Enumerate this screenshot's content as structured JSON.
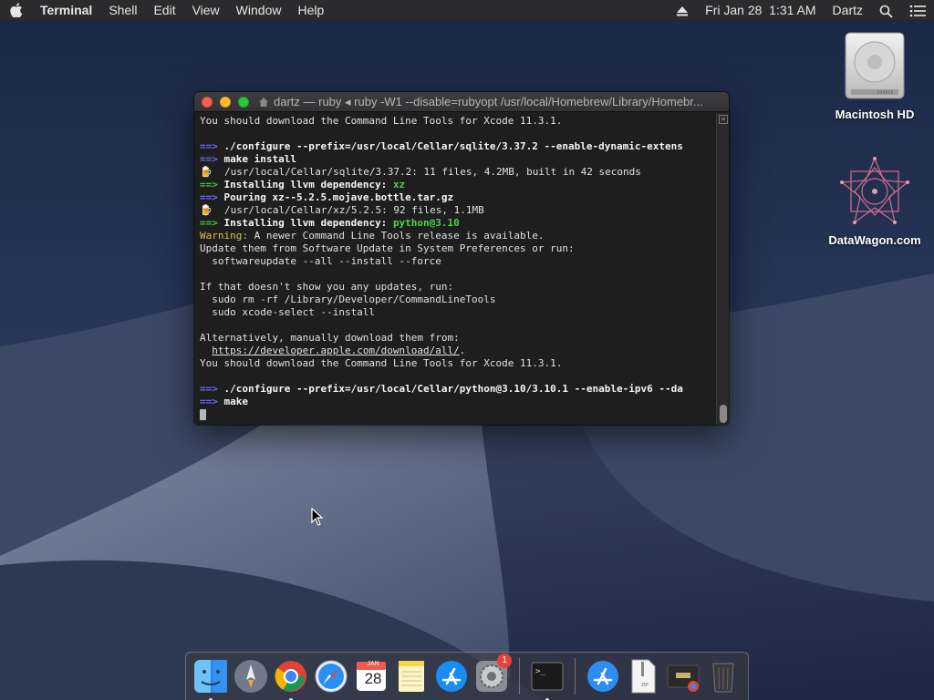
{
  "menubar": {
    "apple": "",
    "app_name": "Terminal",
    "items": [
      "Shell",
      "Edit",
      "View",
      "Window",
      "Help"
    ],
    "clock": "Fri Jan 28  1:31 AM",
    "user": "Dartz"
  },
  "desktop": {
    "icons": [
      {
        "label": "Macintosh HD",
        "icon": "hard-drive-icon"
      },
      {
        "label": "DataWagon.com",
        "icon": "geometric-star-icon"
      }
    ]
  },
  "terminal": {
    "title": "dartz — ruby ◂ ruby -W1 --disable=rubyopt /usr/local/Homebrew/Library/Homebr...",
    "lines": [
      [
        {
          "t": "You should download the Command Line Tools for Xcode 11.3.1.",
          "c": ""
        }
      ],
      [
        {
          "t": "",
          "c": ""
        }
      ],
      [
        {
          "t": "==> ",
          "c": "arrow-blue"
        },
        {
          "t": "./configure --prefix=/usr/local/Cellar/sqlite/3.37.2 --enable-dynamic-extens",
          "c": "bold"
        }
      ],
      [
        {
          "t": "==> ",
          "c": "arrow-blue"
        },
        {
          "t": "make install",
          "c": "bold"
        }
      ],
      [
        {
          "t": "🍺  ",
          "c": "beer"
        },
        {
          "t": "/usr/local/Cellar/sqlite/3.37.2: 11 files, 4.2MB, built in 42 seconds",
          "c": ""
        }
      ],
      [
        {
          "t": "==> ",
          "c": "arrow-green"
        },
        {
          "t": "Installing llvm dependency: ",
          "c": "bold"
        },
        {
          "t": "xz",
          "c": "green"
        }
      ],
      [
        {
          "t": "==> ",
          "c": "arrow-blue"
        },
        {
          "t": "Pouring xz--5.2.5.mojave.bottle.tar.gz",
          "c": "bold"
        }
      ],
      [
        {
          "t": "🍺  ",
          "c": "beer"
        },
        {
          "t": "/usr/local/Cellar/xz/5.2.5: 92 files, 1.1MB",
          "c": ""
        }
      ],
      [
        {
          "t": "==> ",
          "c": "arrow-green"
        },
        {
          "t": "Installing llvm dependency: ",
          "c": "bold"
        },
        {
          "t": "python@3.10",
          "c": "green"
        }
      ],
      [
        {
          "t": "Warning:",
          "c": "yellow"
        },
        {
          "t": " A newer Command Line Tools release is available.",
          "c": ""
        }
      ],
      [
        {
          "t": "Update them from Software Update in System Preferences or run:",
          "c": ""
        }
      ],
      [
        {
          "t": "  softwareupdate --all --install --force",
          "c": ""
        }
      ],
      [
        {
          "t": "",
          "c": ""
        }
      ],
      [
        {
          "t": "If that doesn't show you any updates, run:",
          "c": ""
        }
      ],
      [
        {
          "t": "  sudo rm -rf /Library/Developer/CommandLineTools",
          "c": ""
        }
      ],
      [
        {
          "t": "  sudo xcode-select --install",
          "c": ""
        }
      ],
      [
        {
          "t": "",
          "c": ""
        }
      ],
      [
        {
          "t": "Alternatively, manually download them from:",
          "c": ""
        }
      ],
      [
        {
          "t": "  ",
          "c": ""
        },
        {
          "t": "https://developer.apple.com/download/all/",
          "c": "underline"
        },
        {
          "t": ".",
          "c": ""
        }
      ],
      [
        {
          "t": "You should download the Command Line Tools for Xcode 11.3.1.",
          "c": ""
        }
      ],
      [
        {
          "t": "",
          "c": ""
        }
      ],
      [
        {
          "t": "==> ",
          "c": "arrow-blue"
        },
        {
          "t": "./configure --prefix=/usr/local/Cellar/python@3.10/3.10.1 --enable-ipv6 --da",
          "c": "bold"
        }
      ],
      [
        {
          "t": "==> ",
          "c": "arrow-blue"
        },
        {
          "t": "make",
          "c": "bold"
        }
      ]
    ]
  },
  "dock": {
    "apps": [
      {
        "name": "Finder",
        "icon": "finder-icon",
        "running": true
      },
      {
        "name": "Launchpad",
        "icon": "launchpad-icon",
        "running": false
      },
      {
        "name": "Chrome",
        "icon": "chrome-icon",
        "running": true
      },
      {
        "name": "Safari",
        "icon": "safari-icon",
        "running": false
      },
      {
        "name": "Calendar",
        "icon": "calendar-icon",
        "running": false,
        "month": "JAN",
        "day": "28"
      },
      {
        "name": "Notes",
        "icon": "notes-icon",
        "running": false
      },
      {
        "name": "App Store",
        "icon": "app-store-icon",
        "running": false
      },
      {
        "name": "System Preferences",
        "icon": "system-preferences-icon",
        "running": false,
        "badge": "1"
      },
      {
        "name": "Terminal",
        "icon": "terminal-icon",
        "running": true
      },
      {
        "name": "Downloads",
        "icon": "downloads-folder-icon",
        "running": false
      },
      {
        "name": "Zip Document",
        "icon": "zip-file-icon",
        "running": false,
        "label": "ZIP"
      },
      {
        "name": "Installer",
        "icon": "installer-icon",
        "running": false
      },
      {
        "name": "Trash",
        "icon": "trash-icon",
        "running": false
      }
    ]
  }
}
